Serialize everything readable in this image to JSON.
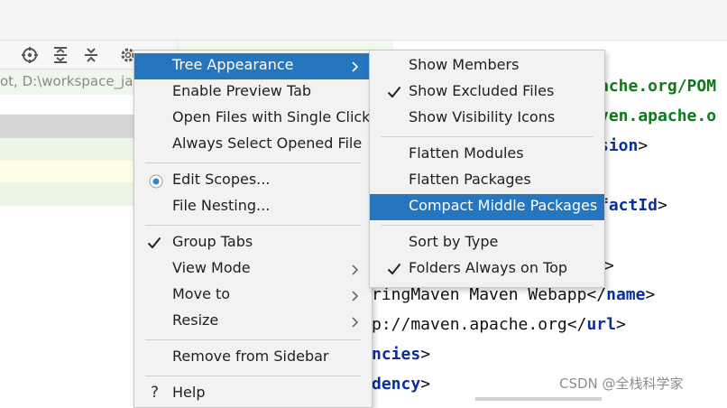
{
  "editor": {
    "path_text": "ot, D:\\workspace_ja",
    "code_lines": [
      {
        "t1": "ache.org/POM",
        "t2": "",
        "t3": ""
      },
      {
        "t1": "ven.apache.o",
        "t2": "",
        "t3": ""
      },
      {
        "t1": "sion",
        "t2": ">",
        "t3": ""
      },
      {
        "t1": "factId",
        "t2": ">",
        "t3": ""
      },
      {
        "t1": ">",
        "t2": "",
        "t3": ""
      },
      {
        "t1": "ringMaven Maven Webapp",
        "t2": "</",
        "t3": "name"
      },
      {
        "t1": "p://maven.apache.org",
        "t2": "</",
        "t3": "url"
      },
      {
        "t1": "ncies",
        "t2": ">",
        "t3": ""
      },
      {
        "t1": "dency",
        "t2": ">",
        "t3": ""
      }
    ]
  },
  "main_menu": {
    "items": [
      {
        "label": "Tree Appearance"
      },
      {
        "label": "Enable Preview Tab"
      },
      {
        "label": "Open Files with Single Click"
      },
      {
        "label": "Always Select Opened File"
      },
      {
        "label": "Edit Scopes..."
      },
      {
        "label": "File Nesting..."
      },
      {
        "label": "Group Tabs"
      },
      {
        "label": "View Mode"
      },
      {
        "label": "Move to"
      },
      {
        "label": "Resize"
      },
      {
        "label": "Remove from Sidebar"
      },
      {
        "label": "Help"
      }
    ]
  },
  "sub_menu": {
    "items": [
      {
        "label": "Show Members"
      },
      {
        "label": "Show Excluded Files"
      },
      {
        "label": "Show Visibility Icons"
      },
      {
        "label": "Flatten Modules"
      },
      {
        "label": "Flatten Packages"
      },
      {
        "label": "Compact Middle Packages"
      },
      {
        "label": "Sort by Type"
      },
      {
        "label": "Folders Always on Top"
      }
    ]
  },
  "watermark": "CSDN @全栈科学家",
  "colors": {
    "selection": "#2675bf",
    "menu_bg": "#f2f2f2",
    "code_tag": "#0a2f9c"
  }
}
